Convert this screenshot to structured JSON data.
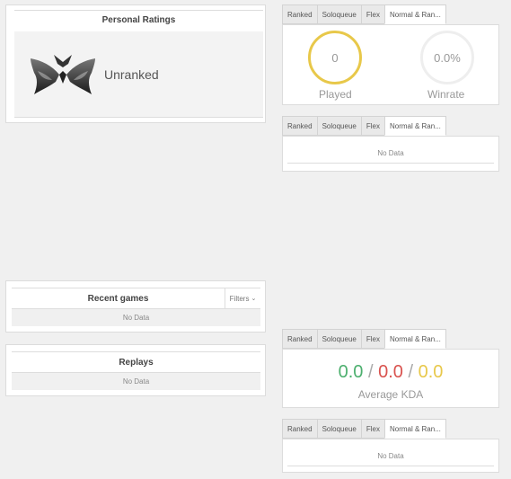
{
  "personal_ratings": {
    "title": "Personal Ratings",
    "rank": "Unranked"
  },
  "tabs": [
    "Ranked",
    "Soloqueue",
    "Flex",
    "Normal & Ran..."
  ],
  "stats": {
    "played_value": "0",
    "played_label": "Played",
    "winrate_value": "0.0%",
    "winrate_label": "Winrate"
  },
  "no_data": "No Data",
  "recent_games": {
    "title": "Recent games",
    "filters": "Filters",
    "empty": "No Data"
  },
  "replays": {
    "title": "Replays",
    "empty": "No Data"
  },
  "kda": {
    "kills": "0.0",
    "deaths": "0.0",
    "assists": "0.0",
    "separator": "/",
    "label": "Average KDA"
  },
  "colors": {
    "played_ring": "#e8c84a",
    "winrate_ring": "#eeeeee",
    "kills": "#4caf6e",
    "deaths": "#d9534f",
    "assists": "#e8c84a"
  }
}
